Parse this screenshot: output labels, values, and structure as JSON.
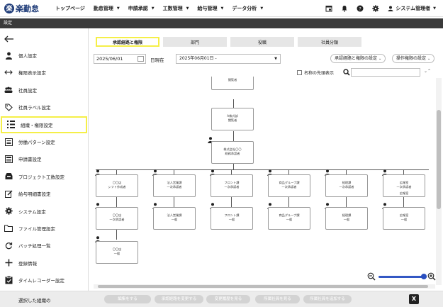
{
  "app": {
    "logo_mark": "楽",
    "logo_text": "楽勤怠"
  },
  "nav": {
    "items": [
      {
        "label": "トップページ",
        "caret": false
      },
      {
        "label": "勤怠管理",
        "caret": true
      },
      {
        "label": "申請承認",
        "caret": true
      },
      {
        "label": "工数管理",
        "caret": true
      },
      {
        "label": "給与管理",
        "caret": true
      },
      {
        "label": "データ分析",
        "caret": true
      }
    ],
    "user": "システム管理者"
  },
  "setting_bar": "設定",
  "sidebar": {
    "items": [
      {
        "label": "個人設定",
        "icon": "person-icon"
      },
      {
        "label": "権限表示設定",
        "icon": "arrows-icon"
      },
      {
        "label": "社員設定",
        "icon": "group-icon"
      },
      {
        "label": "社員ラベル設定",
        "icon": "tag-icon"
      },
      {
        "label": "組織・権限設定",
        "icon": "org-grid-icon"
      },
      {
        "label": "労働パターン設定",
        "icon": "list-icon"
      },
      {
        "label": "申請書設定",
        "icon": "form-icon"
      },
      {
        "label": "プロジェクト工数設定",
        "icon": "inbox-icon"
      },
      {
        "label": "給与明細書設定",
        "icon": "edit-doc-icon"
      },
      {
        "label": "システム設定",
        "icon": "gear-icon"
      },
      {
        "label": "ファイル管理設定",
        "icon": "folder-icon"
      },
      {
        "label": "バッチ処理一覧",
        "icon": "refresh-icon"
      },
      {
        "label": "登録情報",
        "icon": "plus-icon"
      },
      {
        "label": "タイムレコーダー設定",
        "icon": "clipboard-icon"
      }
    ]
  },
  "tabs": [
    "承認経路と権限",
    "部門",
    "役職",
    "社員分類"
  ],
  "filters": {
    "date": "2025/06/01",
    "current_label": "日現在",
    "period": "2025年06月01日 -",
    "btn_route": "承認経路と権限の設定",
    "btn_ops": "操作権限の設定"
  },
  "search": {
    "checkbox_label": "名称の先頭表示",
    "updown": "⌄⌃"
  },
  "org": {
    "top_partial": {
      "line1": "…………",
      "line2": "閲覧者"
    },
    "level1": {
      "line1": "A株式部",
      "line2": "閲覧者"
    },
    "level2": {
      "line1": "株式会社〇〇",
      "line2": "総務承認者"
    },
    "columns": [
      {
        "top": [
          "〇〇店",
          "シフト作成者"
        ],
        "bottom": [
          "〇〇店",
          "一次承認者"
        ],
        "extra": ""
      },
      {
        "top": [
          "法人営業課",
          "一次承認者"
        ],
        "bottom": [
          "法人営業課",
          "一般"
        ],
        "extra": ""
      },
      {
        "top": [
          "フロント課",
          "一次承認者"
        ],
        "bottom": [
          "フロント課",
          "一般"
        ],
        "extra": ""
      },
      {
        "top": [
          "商品グループ課",
          "一次承認者"
        ],
        "bottom": [
          "商品グループ課",
          "一般"
        ],
        "extra": ""
      },
      {
        "top": [
          "経理課",
          "一次承認者"
        ],
        "bottom": [
          "経理課",
          "一般"
        ],
        "extra": ""
      },
      {
        "top": [
          "広報室",
          "一次承認者"
        ],
        "bottom": [
          "広報室",
          "一般"
        ],
        "extra": "広報室"
      }
    ],
    "third": [
      "〇〇店",
      "一般"
    ]
  },
  "bottom": {
    "selected_label": "選択した組織の",
    "buttons": [
      "編集をする",
      "承認経路を変更する",
      "変更履歴を見る",
      "所属社員を見る",
      "所属社員を追加する"
    ],
    "excel": "X"
  },
  "colors": {
    "highlight": "#f5ef48",
    "navy": "#1e3b78",
    "zoom": "#3358c4",
    "setting_bar": "#3a3a3a"
  }
}
